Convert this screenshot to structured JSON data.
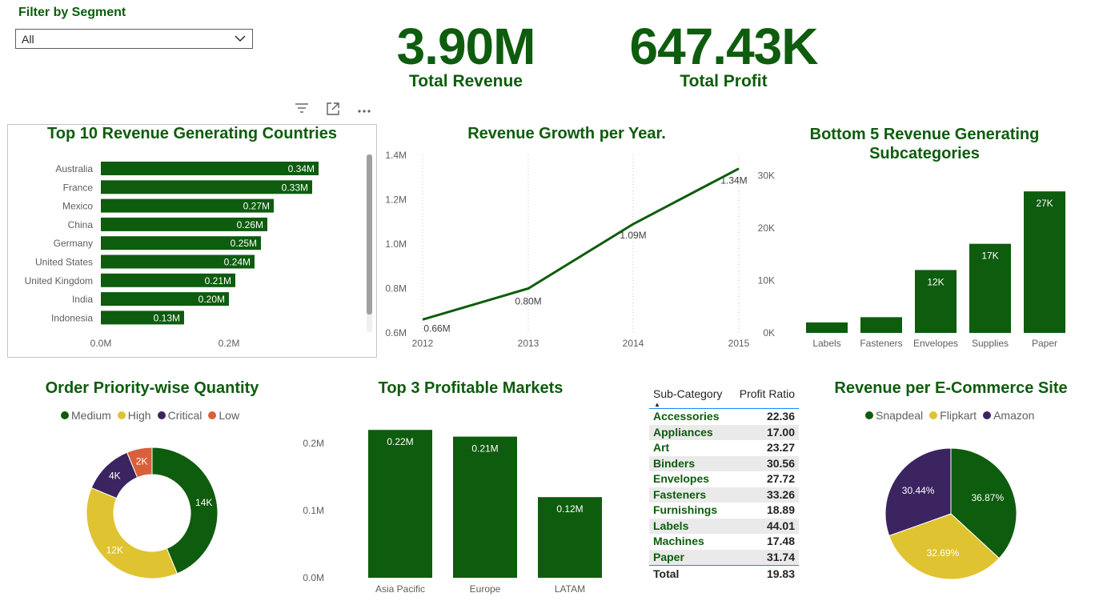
{
  "filter": {
    "title": "Filter by Segment",
    "selected": "All"
  },
  "kpis": [
    {
      "value": "3.90M",
      "label": "Total Revenue"
    },
    {
      "value": "647.43K",
      "label": "Total Profit"
    }
  ],
  "visual_header_icons": [
    "filter-icon",
    "focus-mode-icon",
    "more-options-icon"
  ],
  "colors": {
    "green": "#0e5c0e",
    "yellow": "#e0c331",
    "purple": "#3b2460",
    "orange": "#d9603b"
  },
  "chart_data": [
    {
      "id": "countries",
      "type": "bar",
      "orientation": "horizontal",
      "title": "Top 10 Revenue Generating Countries",
      "categories": [
        "Australia",
        "France",
        "Mexico",
        "China",
        "Germany",
        "United States",
        "United Kingdom",
        "India",
        "Indonesia"
      ],
      "values": [
        0.34,
        0.33,
        0.27,
        0.26,
        0.25,
        0.24,
        0.21,
        0.2,
        0.13
      ],
      "data_labels": [
        "0.34M",
        "0.33M",
        "0.27M",
        "0.26M",
        "0.25M",
        "0.24M",
        "0.21M",
        "0.20M",
        "0.13M"
      ],
      "xticks": [
        "0.0M",
        "0.2M"
      ],
      "xlim": [
        0,
        0.4
      ],
      "unit": "M"
    },
    {
      "id": "growth",
      "type": "line",
      "title": "Revenue Growth per Year.",
      "x": [
        "2012",
        "2013",
        "2014",
        "2015"
      ],
      "values": [
        0.66,
        0.8,
        1.09,
        1.34
      ],
      "data_labels": [
        "0.66M",
        "0.80M",
        "1.09M",
        "1.34M"
      ],
      "yticks": [
        "0.6M",
        "0.8M",
        "1.0M",
        "1.2M",
        "1.4M"
      ],
      "ylim": [
        0.6,
        1.4
      ],
      "grid": "vertical dotted"
    },
    {
      "id": "subcats",
      "type": "bar",
      "title": "Bottom 5 Revenue Generating Subcategories",
      "categories": [
        "Labels",
        "Fasteners",
        "Envelopes",
        "Supplies",
        "Paper"
      ],
      "values": [
        2,
        3,
        12,
        17,
        27
      ],
      "data_labels": [
        "",
        "",
        "12K",
        "17K",
        "27K"
      ],
      "yticks": [
        "0K",
        "10K",
        "20K",
        "30K"
      ],
      "ylim": [
        0,
        30
      ]
    },
    {
      "id": "priority",
      "type": "pie",
      "variant": "donut",
      "title": "Order Priority-wise Quantity",
      "legend": [
        "Medium",
        "High",
        "Critical",
        "Low"
      ],
      "values": [
        14,
        12,
        4,
        2
      ],
      "data_labels": [
        "14K",
        "12K",
        "4K",
        "2K"
      ],
      "colors": [
        "#0e5c0e",
        "#e0c331",
        "#3b2460",
        "#d9603b"
      ]
    },
    {
      "id": "markets",
      "type": "bar",
      "title": "Top 3 Profitable Markets",
      "categories": [
        "Asia Pacific",
        "Europe",
        "LATAM"
      ],
      "values": [
        0.22,
        0.21,
        0.12
      ],
      "data_labels": [
        "0.22M",
        "0.21M",
        "0.12M"
      ],
      "yticks": [
        "0.0M",
        "0.1M",
        "0.2M"
      ],
      "ylim": [
        0,
        0.2
      ]
    },
    {
      "id": "ecommerce",
      "type": "pie",
      "title": "Revenue per E-Commerce Site",
      "legend": [
        "Snapdeal",
        "Flipkart",
        "Amazon"
      ],
      "values": [
        36.87,
        32.69,
        30.44
      ],
      "data_labels": [
        "36.87%",
        "32.69%",
        "30.44%"
      ],
      "colors": [
        "#0e5c0e",
        "#e0c331",
        "#3b2460"
      ]
    }
  ],
  "profit_table": {
    "headers": [
      "Sub-Category",
      "Profit Ratio"
    ],
    "rows": [
      [
        "Accessories",
        "22.36"
      ],
      [
        "Appliances",
        "17.00"
      ],
      [
        "Art",
        "23.27"
      ],
      [
        "Binders",
        "30.56"
      ],
      [
        "Envelopes",
        "27.72"
      ],
      [
        "Fasteners",
        "33.26"
      ],
      [
        "Furnishings",
        "18.89"
      ],
      [
        "Labels",
        "44.01"
      ],
      [
        "Machines",
        "17.48"
      ],
      [
        "Paper",
        "31.74"
      ]
    ],
    "total": [
      "Total",
      "19.83"
    ]
  }
}
